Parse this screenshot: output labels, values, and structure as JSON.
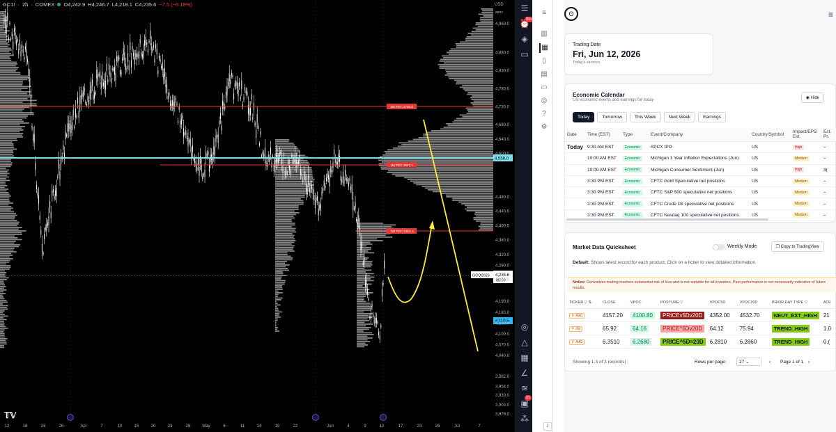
{
  "chart": {
    "symbol_bar": {
      "symbol": "GC1!",
      "interval": "2h",
      "exchange": "COMEX",
      "open": "O4,242.9",
      "high": "H4,246.7",
      "low": "L4,218.1",
      "close": "C4,235.6",
      "change": "−7.5 (−0.18%)"
    },
    "currency": "USD",
    "apoz_label": "apoz",
    "price_labels": [
      "4,960.0",
      "4,880.0",
      "4,830.0",
      "4,780.0",
      "4,730.0",
      "4,680.0",
      "4,640.0",
      "4,600.0",
      "4,558.0",
      "4,480.0",
      "4,440.0",
      "4,400.0",
      "4,360.0",
      "4,320.0",
      "4,290.0",
      "4,250.0",
      "4,235.6",
      "4,190.0",
      "4,160.0",
      "4,130.0",
      "4,100.0",
      "4,070.0",
      "4,040.0",
      "3,982.0",
      "3,954.0",
      "3,930.0",
      "3,903.0",
      "3,878.0"
    ],
    "time_labels": [
      "12",
      "18",
      "23",
      "26",
      "Apr",
      "7",
      "10",
      "15",
      "20",
      "23",
      "28",
      "May",
      "6",
      "11",
      "14",
      "19",
      "22",
      "Jun",
      "4",
      "9",
      "12",
      "17",
      "23",
      "26",
      "Jul",
      "7"
    ],
    "poc_lines": [
      {
        "label": "3M POC 4705.8"
      },
      {
        "label": "1M POC 4537.1"
      },
      {
        "label": "1W POC 4354.4"
      }
    ],
    "highlight_price": "4,558.0",
    "current_price": "4,235.6",
    "current_time": "05:09",
    "ticker_tag": "GCQ2026",
    "low_tag": "4,110.5",
    "colors": {
      "poc_red": "#e53935",
      "highlight_cyan": "#7fe0f0",
      "arrow_yellow": "#ffee33",
      "candle_white": "#ffffff",
      "volume_gray": "#9e9e9e"
    }
  },
  "toolbar": {
    "badges": [
      "99+",
      "21"
    ]
  },
  "app": {
    "trading_date": {
      "label": "Trading Date",
      "date": "Fri, Jun 12, 2026",
      "sub": "Today's session"
    },
    "econ": {
      "title": "Economic Calendar",
      "subtitle": "US economic events and earnings for today",
      "hide_label": "Hide",
      "tabs": [
        "Today",
        "Tomorrow",
        "This Week",
        "Next Week",
        "Earnings"
      ],
      "columns": [
        "Date",
        "Time (EST)",
        "Type",
        "Event/Company",
        "Country/Symbol",
        "Impact/EPS Est.",
        "Est. Pr."
      ],
      "rows": [
        {
          "date": "Today",
          "time": "9:30 AM EST",
          "type": "Economic",
          "event": "SPCX IPO",
          "country": "US",
          "impact": "High",
          "est": "–"
        },
        {
          "date": "",
          "time": "10:00 AM EST",
          "type": "Economic",
          "event": "Michigan 1 Year Inflation Expectations (Jun)",
          "country": "US",
          "impact": "Medium",
          "est": "–"
        },
        {
          "date": "",
          "time": "10:00 AM EST",
          "type": "Economic",
          "event": "Michigan Consumer Sentiment (Jun)",
          "country": "US",
          "impact": "High",
          "est": "4("
        },
        {
          "date": "",
          "time": "3:30 PM EST",
          "type": "Economic",
          "event": "CFTC Gold Speculative net positions",
          "country": "US",
          "impact": "Medium",
          "est": "–"
        },
        {
          "date": "",
          "time": "3:30 PM EST",
          "type": "Economic",
          "event": "CFTC S&P 500 speculative net positions",
          "country": "US",
          "impact": "Medium",
          "est": "–"
        },
        {
          "date": "",
          "time": "3:30 PM EST",
          "type": "Economic",
          "event": "CFTC Crude Oil speculative net positions",
          "country": "US",
          "impact": "Medium",
          "est": "–"
        },
        {
          "date": "",
          "time": "3:30 PM EST",
          "type": "Economic",
          "event": "CFTC Nasdaq 100 speculative net positions",
          "country": "US",
          "impact": "Medium",
          "est": "–"
        }
      ]
    },
    "market": {
      "title": "Market Data Quicksheet",
      "weekly_label": "Weekly Mode",
      "copy_label": "Copy to TradingView",
      "default_label": "Default:",
      "default_text": "Shows latest record for each product. Click on a ticker to view detailed information.",
      "notice_label": "Notice:",
      "notice_text": "Derivatives trading involves substantial risk of loss and is not suitable for all investors. Past performance is not necessarily indicative of future results.",
      "columns": [
        "TICKER ▽ ⇅",
        "CLOSE",
        "VPOC",
        "POSTURE ▽",
        "VPOC5D",
        "VPOC20D",
        "PRIOR DAY TYPE ▽",
        "ATR"
      ],
      "rows": [
        {
          "ticker": "/GC",
          "close": "4157.20",
          "vpoc": "4100.80",
          "posture": "PRICEv5Dv20D",
          "vpoc5d": "4352.00",
          "vpoc20d": "4532.70",
          "pdt": "NEUT_EXT_HIGH",
          "atr": "21"
        },
        {
          "ticker": "/SI",
          "close": "65.92",
          "vpoc": "64.16",
          "posture": "PRICE^5Dv20D",
          "vpoc5d": "64.12",
          "vpoc20d": "75.94",
          "pdt": "TREND_HIGH",
          "atr": "1.0"
        },
        {
          "ticker": "/HG",
          "close": "6.3510",
          "vpoc": "6.2680",
          "posture": "PRICE^5D=20D",
          "vpoc5d": "6.2810",
          "vpoc20d": "6.2860",
          "pdt": "TREND_HIGH",
          "atr": "0.("
        }
      ],
      "showing": "Showing 1-3 of 3 record(s)",
      "rows_per_page_label": "Rows per page:",
      "rows_per_page": "27",
      "page_label": "Page 1 of 1"
    }
  }
}
